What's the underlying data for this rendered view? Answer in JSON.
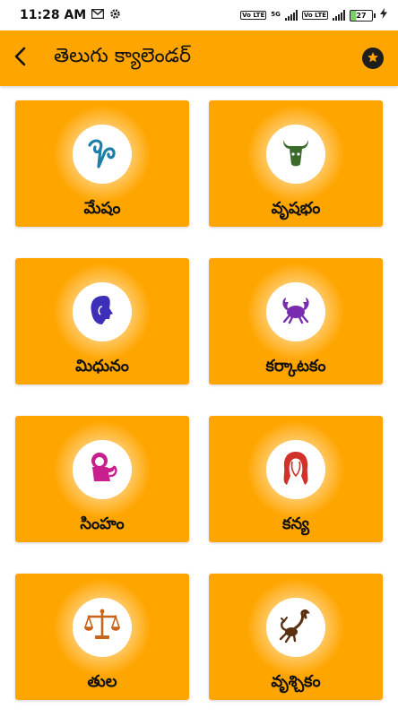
{
  "status_bar": {
    "time": "11:28 AM",
    "battery": "27",
    "net1": "Vo LTE",
    "net2": "Vo LTE",
    "net_gen": "5G"
  },
  "app_bar": {
    "title": "తెలుగు క్యాలెండర్"
  },
  "signs": [
    {
      "label": "మేషం",
      "icon": "aries-icon",
      "color": "#1d7fa8"
    },
    {
      "label": "వృషభం",
      "icon": "taurus-icon",
      "color": "#3a6b2a"
    },
    {
      "label": "మిధునం",
      "icon": "gemini-icon",
      "color": "#3d2fb8"
    },
    {
      "label": "కర్కాటకం",
      "icon": "cancer-icon",
      "color": "#7a2cb0"
    },
    {
      "label": "సింహం",
      "icon": "leo-icon",
      "color": "#c81e8e"
    },
    {
      "label": "కన్య",
      "icon": "virgo-icon",
      "color": "#d0322a"
    },
    {
      "label": "తుల",
      "icon": "libra-icon",
      "color": "#c8641a"
    },
    {
      "label": "వృశ్చికం",
      "icon": "scorpio-icon",
      "color": "#5b2f12"
    }
  ]
}
